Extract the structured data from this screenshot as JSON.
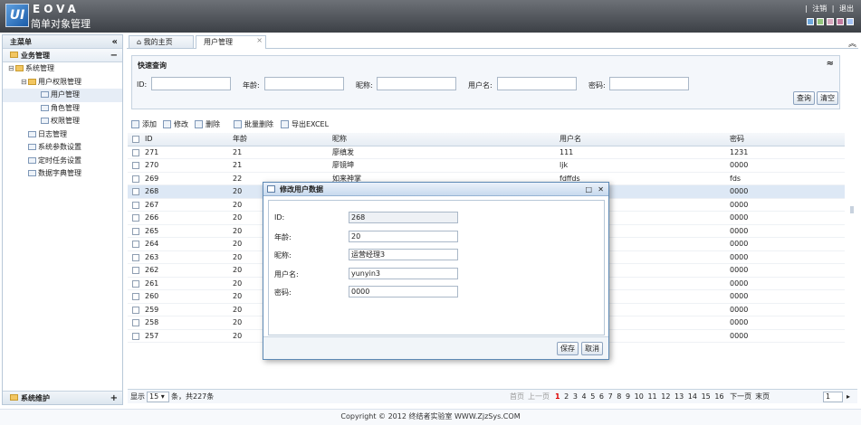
{
  "header": {
    "logo_glyph": "UI",
    "app_name": "EOVA",
    "app_subtitle": "简单对象管理",
    "links": [
      "注销",
      "退出"
    ],
    "theme_colors": [
      "#6fa8dc",
      "#93c47d",
      "#d5a6bd",
      "#c27ba0",
      "#a4c2f4"
    ]
  },
  "sidebar": {
    "title": "主菜单",
    "collapse_glyph": "«",
    "section": "业务管理",
    "section_tool": "−",
    "tree": [
      {
        "label": "系统管理",
        "level": 0,
        "type": "folder",
        "toggle": "⊟"
      },
      {
        "label": "用户权限管理",
        "level": 1,
        "type": "folder",
        "toggle": "⊟"
      },
      {
        "label": "用户管理",
        "level": 2,
        "type": "file",
        "selected": true
      },
      {
        "label": "角色管理",
        "level": 2,
        "type": "file"
      },
      {
        "label": "权限管理",
        "level": 2,
        "type": "file"
      },
      {
        "label": "日志管理",
        "level": 1,
        "type": "file"
      },
      {
        "label": "系统参数设置",
        "level": 1,
        "type": "file"
      },
      {
        "label": "定时任务设置",
        "level": 1,
        "type": "file"
      },
      {
        "label": "数据字典管理",
        "level": 1,
        "type": "file"
      }
    ],
    "bottom_section": "系统维护",
    "bottom_tool": "+"
  },
  "tabs": [
    {
      "label": "我的主页",
      "icon": "⌂"
    },
    {
      "label": "用户管理",
      "close": "×"
    }
  ],
  "query": {
    "title": "快速查询",
    "collapse_glyph": "≈",
    "fields": [
      "ID:",
      "年龄:",
      "昵称:",
      "用户名:",
      "密码:"
    ],
    "search_label": "查询",
    "clear_label": "清空"
  },
  "toolbar": {
    "add": "添加",
    "edit": "修改",
    "delete": "删除",
    "batch_delete": "批量删除",
    "export": "导出EXCEL"
  },
  "grid": {
    "columns": [
      "ID",
      "年龄",
      "昵称",
      "用户名",
      "密码"
    ],
    "rows": [
      [
        "271",
        "21",
        "廖缜发",
        "111",
        "1231"
      ],
      [
        "270",
        "21",
        "廖镜坤",
        "ljk",
        "0000"
      ],
      [
        "269",
        "22",
        "如来神掌",
        "fdffds",
        "fds"
      ],
      [
        "268",
        "20",
        "",
        "",
        "0000"
      ],
      [
        "267",
        "20",
        "",
        "",
        "0000"
      ],
      [
        "266",
        "20",
        "",
        "",
        "0000"
      ],
      [
        "265",
        "20",
        "",
        "",
        "0000"
      ],
      [
        "264",
        "20",
        "",
        "",
        "0000"
      ],
      [
        "263",
        "20",
        "",
        "",
        "0000"
      ],
      [
        "262",
        "20",
        "",
        "",
        "0000"
      ],
      [
        "261",
        "20",
        "",
        "",
        "0000"
      ],
      [
        "260",
        "20",
        "",
        "",
        "0000"
      ],
      [
        "259",
        "20",
        "",
        "",
        "0000"
      ],
      [
        "258",
        "20",
        "",
        "",
        "0000"
      ],
      [
        "257",
        "20",
        "",
        "",
        "0000"
      ]
    ]
  },
  "pager": {
    "show": "显示",
    "page_size": "15",
    "summary": "条，共227条",
    "first": "首页",
    "prev": "上一页",
    "pages": [
      "1",
      "2",
      "3",
      "4",
      "5",
      "6",
      "7",
      "8",
      "9",
      "10",
      "11",
      "12",
      "13",
      "14",
      "15",
      "16"
    ],
    "current_page": "1",
    "next": "下一页",
    "last": "末页",
    "goto_value": "1",
    "go_glyph": "▸"
  },
  "dialog": {
    "title": "修改用户数据",
    "max_glyph": "□",
    "close_glyph": "✕",
    "fields": [
      {
        "label": "ID:",
        "value": "268",
        "readonly": true
      },
      {
        "label": "年龄:",
        "value": "20"
      },
      {
        "label": "昵称:",
        "value": "运营经理3"
      },
      {
        "label": "用户名:",
        "value": "yunyin3"
      },
      {
        "label": "密码:",
        "value": "0000"
      }
    ],
    "save_label": "保存",
    "cancel_label": "取消"
  },
  "footer": {
    "copyright": "Copyright © 2012 终结者实验室 WWW.ZjzSys.COM"
  }
}
